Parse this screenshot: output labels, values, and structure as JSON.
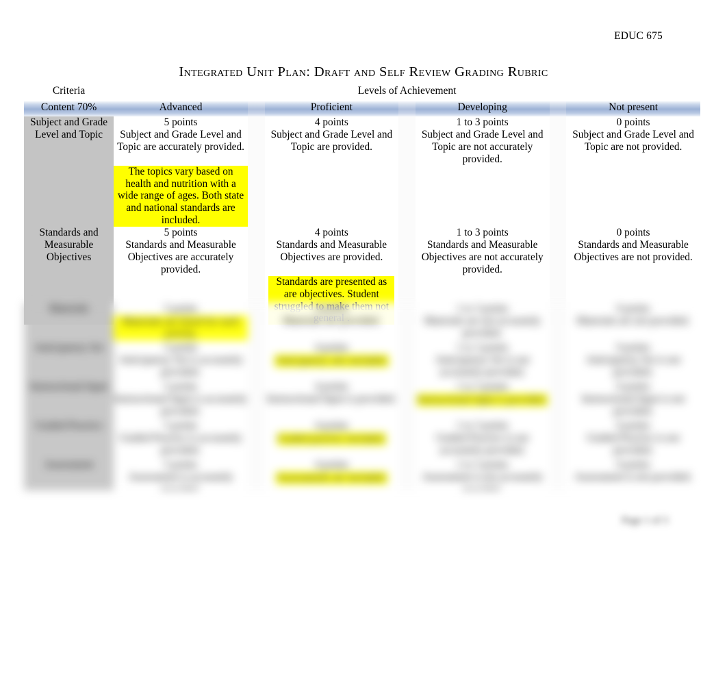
{
  "header": {
    "course_code": "EDUC 675"
  },
  "title": "Integrated  Unit Plan: Draft and Self Review Grading Rubric",
  "table": {
    "criteria_header": "Criteria",
    "levels_header": "Levels of Achievement",
    "band": {
      "criteria_weight": "Content 70%",
      "levels": [
        "Advanced",
        "Proficient",
        "Developing",
        "Not present"
      ]
    },
    "rows": [
      {
        "criterion": "Subject and Grade Level and Topic",
        "cells": [
          {
            "points": "5 points",
            "description": "Subject and Grade Level and Topic are accurately provided.",
            "comment": "The topics vary based on health and nutrition with a wide range of ages. Both state and national standards are included."
          },
          {
            "points": "4 points",
            "description": "Subject and Grade Level and Topic are provided.",
            "comment": ""
          },
          {
            "points": "1 to 3 points",
            "description": "Subject and Grade Level and Topic are not accurately provided.",
            "comment": ""
          },
          {
            "points": "0 points",
            "description": "Subject and Grade Level and Topic are not provided.",
            "comment": ""
          }
        ]
      },
      {
        "criterion": "Standards and Measurable Objectives",
        "cells": [
          {
            "points": "5 points",
            "description": "Standards and Measurable Objectives are accurately provided.",
            "comment": ""
          },
          {
            "points": "4 points",
            "description": "Standards and Measurable Objectives are provided.",
            "comment": "Standards are presented as are objectives. Student struggled to make them not general ."
          },
          {
            "points": "1 to 3 points",
            "description": "Standards and Measurable Objectives are not accurately provided.",
            "comment": ""
          },
          {
            "points": "0 points",
            "description": "Standards and Measurable Objectives are not provided.",
            "comment": ""
          }
        ]
      }
    ],
    "obscured_rows": [
      {
        "criterion": "Materials",
        "cells": [
          {
            "points": "5 points",
            "description": "Materials are accurately provided.",
            "comment": "Materials are listed for each activity."
          },
          {
            "points": "4 points",
            "description": "Materials are provided.",
            "comment": ""
          },
          {
            "points": "1 to 3 points",
            "description": "Materials are not accurately provided.",
            "comment": ""
          },
          {
            "points": "0 points",
            "description": "Materials are not provided.",
            "comment": ""
          }
        ]
      },
      {
        "criterion": "Anticipatory Set",
        "cells": [
          {
            "points": "5 points",
            "description": "Anticipatory Set is accurately provided.",
            "comment": ""
          },
          {
            "points": "4 points",
            "description": "Anticipatory Set is provided.",
            "comment": "Anticipatory sets included."
          },
          {
            "points": "1 to 3 points",
            "description": "Anticipatory Set is not accurately provided.",
            "comment": ""
          },
          {
            "points": "0 points",
            "description": "Anticipatory Set is not provided.",
            "comment": ""
          }
        ]
      },
      {
        "criterion": "Instructional Input",
        "cells": [
          {
            "points": "5 points",
            "description": "Instructional Input is accurately provided.",
            "comment": ""
          },
          {
            "points": "4 points",
            "description": "Instructional Input is provided.",
            "comment": ""
          },
          {
            "points": "1 to 3 points",
            "description": "Instructional Input is not accurately provided.",
            "comment": "Instructional input is provided."
          },
          {
            "points": "0 points",
            "description": "Instructional Input is not provided.",
            "comment": ""
          }
        ]
      },
      {
        "criterion": "Guided Practice",
        "cells": [
          {
            "points": "5 points",
            "description": "Guided Practice is accurately provided.",
            "comment": ""
          },
          {
            "points": "4 points",
            "description": "Guided Practice is provided.",
            "comment": "Guided practice included."
          },
          {
            "points": "1 to 3 points",
            "description": "Guided Practice is not accurately provided.",
            "comment": ""
          },
          {
            "points": "0 points",
            "description": "Guided Practice is not provided.",
            "comment": ""
          }
        ]
      },
      {
        "criterion": "Assessment",
        "cells": [
          {
            "points": "5 points",
            "description": "Assessment is accurately provided.",
            "comment": ""
          },
          {
            "points": "4 points",
            "description": "Assessment is provided.",
            "comment": "Assessments are included."
          },
          {
            "points": "1 to 3 points",
            "description": "Assessment is not accurately provided.",
            "comment": ""
          },
          {
            "points": "0 points",
            "description": "Assessment is not provided.",
            "comment": ""
          }
        ]
      }
    ]
  },
  "footer": {
    "page_number": "Page 1 of 3"
  },
  "colors": {
    "band_blue": "#9db3d6",
    "criteria_gray": "#c4c4c4",
    "highlight_yellow": "#ffff00",
    "text": "#000000"
  }
}
